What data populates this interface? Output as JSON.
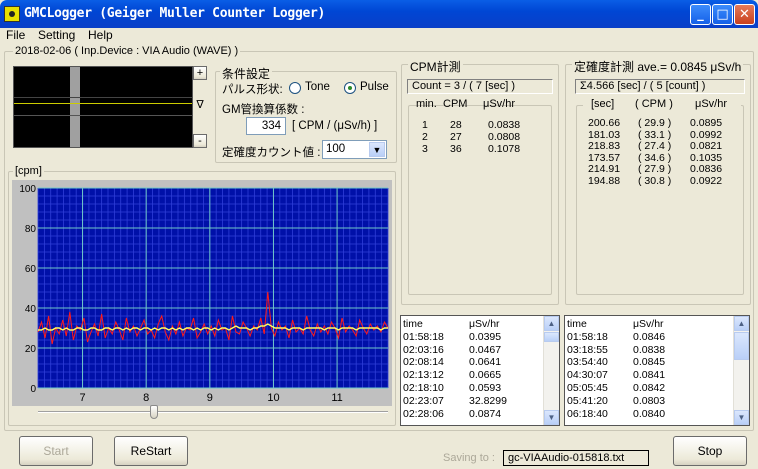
{
  "window": {
    "title": "GMCLogger (Geiger Muller Counter Logger)",
    "minimize": "_",
    "maximize": "□",
    "close": "✕"
  },
  "menu": [
    "File",
    "Setting",
    "Help"
  ],
  "header_group": "2018-02-06 ( Inp.Device : VIA Audio (WAVE) )",
  "scope": {
    "plus": "+",
    "minus": "-",
    "trigger": "∇"
  },
  "conditions": {
    "title": "条件設定",
    "pulse_label": "パルス形状:",
    "options": [
      "Tone",
      "Pulse"
    ],
    "selected": "Pulse",
    "gm_label": "GM管換算係数 :",
    "gm_value": "334",
    "gm_unit": "[ CPM / (μSv/h) ]",
    "count_label": "定確度カウント値 :",
    "count_value": "100"
  },
  "cpm_panel": {
    "title": "CPM計測",
    "count": "Count = 3 / ( 7 [sec] )",
    "headers": [
      "min.",
      "CPM",
      "μSv/hr"
    ],
    "rows": [
      [
        "1",
        "28",
        "0.0838"
      ],
      [
        "2",
        "27",
        "0.0808"
      ],
      [
        "3",
        "36",
        "0.1078"
      ]
    ]
  },
  "accuracy_panel": {
    "title": "定確度計測 ave.= 0.0845 μSv/h",
    "summary": "Σ4.566 [sec] / ( 5 [count] )",
    "headers": [
      "[sec]",
      "( CPM )",
      "μSv/hr"
    ],
    "rows": [
      [
        "200.66",
        "( 29.9 )",
        "0.0895"
      ],
      [
        "181.03",
        "( 33.1 )",
        "0.0992"
      ],
      [
        "218.83",
        "( 27.4 )",
        "0.0821"
      ],
      [
        "173.57",
        "( 34.6 )",
        "0.1035"
      ],
      [
        "214.91",
        "( 27.9 )",
        "0.0836"
      ],
      [
        "194.88",
        "( 30.8 )",
        "0.0922"
      ]
    ]
  },
  "log1": {
    "headers": [
      "time",
      "μSv/hr"
    ],
    "rows": [
      [
        "01:58:18",
        "0.0395"
      ],
      [
        "02:03:16",
        "0.0467"
      ],
      [
        "02:08:14",
        "0.0641"
      ],
      [
        "02:13:12",
        "0.0665"
      ],
      [
        "02:18:10",
        "0.0593"
      ],
      [
        "02:23:07",
        "32.8299"
      ],
      [
        "02:28:06",
        "0.0874"
      ]
    ]
  },
  "log2": {
    "headers": [
      "time",
      "μSv/hr"
    ],
    "rows": [
      [
        "01:58:18",
        "0.0846"
      ],
      [
        "03:18:55",
        "0.0838"
      ],
      [
        "03:54:40",
        "0.0845"
      ],
      [
        "04:30:07",
        "0.0841"
      ],
      [
        "05:05:45",
        "0.0842"
      ],
      [
        "05:41:20",
        "0.0803"
      ],
      [
        "06:18:40",
        "0.0840"
      ]
    ]
  },
  "chart_data": {
    "type": "line",
    "title": "",
    "ylabel": "[cpm]",
    "xlabel": "",
    "ylim": [
      0,
      100
    ],
    "xlim": [
      6.3,
      11.8
    ],
    "yticks": [
      "100",
      "80",
      "60",
      "40",
      "20",
      "0"
    ],
    "xticks": [
      "7",
      "8",
      "9",
      "10",
      "11"
    ],
    "grid": true,
    "colors": {
      "background": "#0010a8",
      "minor_grid": "#2f3fd8",
      "major_grid": "#70c8c8",
      "raw": "#ff1a1a",
      "smooth": "#ffff60"
    },
    "series": [
      {
        "values": [
          28,
          33,
          25,
          36,
          22,
          30,
          27,
          34,
          26,
          38,
          24,
          31,
          29,
          35,
          23,
          28,
          32,
          26,
          37,
          25,
          30,
          27,
          33,
          29,
          24,
          35,
          28,
          31,
          26,
          30,
          34,
          27,
          29,
          25,
          32,
          36,
          28,
          24,
          31,
          27,
          33,
          26,
          30,
          29,
          35,
          25,
          28,
          32,
          27,
          31,
          26,
          34,
          29,
          30,
          24,
          36,
          28,
          27,
          33,
          30,
          26,
          31,
          29,
          35,
          27,
          48,
          30,
          26,
          33,
          29,
          31,
          25,
          34,
          28,
          30,
          27,
          36,
          29,
          26,
          32,
          28,
          31,
          27,
          33,
          30,
          25,
          35,
          28,
          31,
          29,
          26,
          34,
          30,
          27,
          32,
          29,
          31,
          28,
          33,
          30
        ]
      },
      {
        "values": [
          29,
          29,
          30,
          29,
          29,
          30,
          30,
          29,
          30,
          29,
          29,
          30,
          30,
          29,
          29,
          30,
          30,
          29,
          29,
          30,
          30,
          29,
          30,
          30,
          29,
          30,
          29,
          30,
          30,
          29,
          30,
          30,
          29,
          30,
          29,
          30,
          30,
          29,
          30,
          29,
          30,
          29,
          30,
          30,
          29,
          30,
          29,
          30,
          30,
          29,
          30,
          29,
          30,
          30,
          29,
          30,
          31,
          30,
          30,
          30,
          29,
          30,
          30,
          31,
          31,
          32,
          31,
          30,
          30,
          30,
          30,
          29,
          30,
          30,
          30,
          29,
          30,
          30,
          30,
          30,
          30,
          29,
          30,
          30,
          30,
          29,
          30,
          30,
          30,
          30,
          29,
          30,
          30,
          30,
          30,
          30,
          30,
          29,
          30,
          30
        ]
      }
    ]
  },
  "buttons": {
    "start": "Start",
    "restart": "ReStart",
    "stop": "Stop"
  },
  "saving": {
    "label": "Saving to :",
    "file": "gc-VIAAudio-015818.txt"
  }
}
